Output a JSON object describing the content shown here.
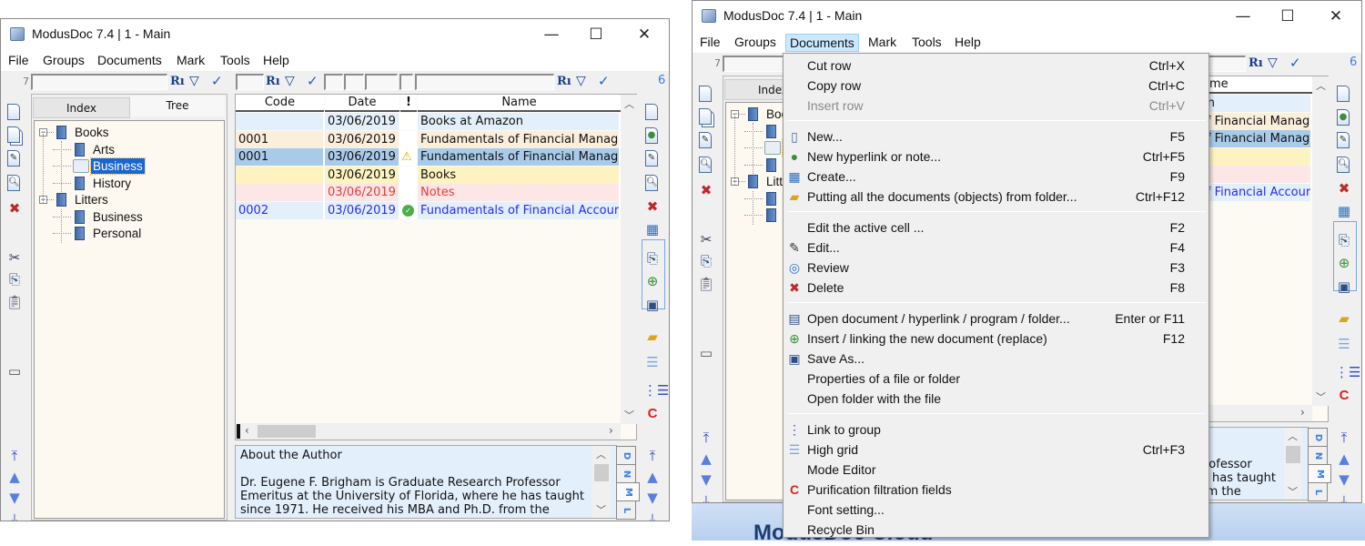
{
  "window": {
    "title": "ModusDoc 7.4 | 1 - Main",
    "controls": {
      "minimize": "—",
      "maximize": "☐",
      "close": "✕"
    }
  },
  "menubar": [
    "File",
    "Groups",
    "Documents",
    "Mark",
    "Tools",
    "Help"
  ],
  "active_menu": "Documents",
  "filter_bar": {
    "left_count": "7",
    "right_count": "6",
    "filter_labels": [
      "Rı",
      "Rı",
      "Rı"
    ]
  },
  "tabs": {
    "index": "Index",
    "tree": "Tree",
    "selected": "Tree"
  },
  "tree": [
    {
      "label": "Books",
      "level": 0,
      "expanded": true
    },
    {
      "label": "Arts",
      "level": 1
    },
    {
      "label": "Business",
      "level": 1,
      "selected": true,
      "icon": "open-book"
    },
    {
      "label": "History",
      "level": 1
    },
    {
      "label": "Litters",
      "level": 0,
      "expanded": true
    },
    {
      "label": "Business",
      "level": 1
    },
    {
      "label": "Personal",
      "level": 1
    }
  ],
  "grid": {
    "columns": [
      "Code",
      "Date",
      "!",
      "Name"
    ],
    "rows": [
      {
        "code": "",
        "date": "03/06/2019",
        "flag": "",
        "name": "Books at Amazon",
        "bg": "#e3effb",
        "color": "#111111"
      },
      {
        "code": "0001",
        "date": "03/06/2019",
        "flag": "",
        "name": "Fundamentals of Financial Manag",
        "bg": "#fbeedb",
        "color": "#111111"
      },
      {
        "code": "0001",
        "date": "03/06/2019",
        "flag": "warning",
        "name": "Fundamentals of Financial Manag",
        "bg": "#a9cbea",
        "color": "#111111"
      },
      {
        "code": "",
        "date": "03/06/2019",
        "flag": "",
        "name": "Books",
        "bg": "#fdf3c0",
        "color": "#111111"
      },
      {
        "code": "",
        "date": "03/06/2019",
        "flag": "",
        "name": "Notes",
        "bg": "#fde6e6",
        "color": "#e83a3a"
      },
      {
        "code": "0002",
        "date": "03/06/2019",
        "flag": "ok",
        "name": "Fundamentals of Financial Accour",
        "bg": "#e3effb",
        "color": "#2b2bef"
      }
    ]
  },
  "notes": {
    "lines": [
      "About the Author",
      "",
      "Dr. Eugene F. Brigham is Graduate Research Professor",
      "Emeritus at the University of Florida, where he has taught",
      "since 1971. He received his MBA and Ph.D. from the"
    ],
    "tabs": [
      "D",
      "N",
      "M",
      "L"
    ]
  },
  "documents_menu": [
    {
      "label": "Cut row",
      "shortcut": "Ctrl+X"
    },
    {
      "label": "Copy row",
      "shortcut": "Ctrl+C"
    },
    {
      "label": "Insert row",
      "shortcut": "Ctrl+V",
      "disabled": true
    },
    {
      "separator": true
    },
    {
      "label": "New...",
      "shortcut": "F5",
      "icon": "new-document"
    },
    {
      "label": "New hyperlink or note...",
      "shortcut": "Ctrl+F5",
      "icon": "globe-document"
    },
    {
      "label": "Create...",
      "shortcut": "F9",
      "icon": "create-form"
    },
    {
      "label": "Putting all the documents (objects) from folder...",
      "shortcut": "Ctrl+F12",
      "icon": "folder-documents"
    },
    {
      "separator": true
    },
    {
      "label": "Edit the active cell ...",
      "shortcut": "F2"
    },
    {
      "label": "Edit...",
      "shortcut": "F4",
      "icon": "edit-pencil"
    },
    {
      "label": "Review",
      "shortcut": "F3",
      "icon": "review-magnifier"
    },
    {
      "label": "Delete",
      "shortcut": "F8",
      "icon": "delete-x"
    },
    {
      "separator": true
    },
    {
      "label": "Open document / hyperlink / program / folder...",
      "shortcut": "Enter or F11",
      "icon": "open-document"
    },
    {
      "label": "Insert / linking the new document (replace)",
      "shortcut": "F12",
      "icon": "insert-link"
    },
    {
      "label": "Save As...",
      "shortcut": "",
      "icon": "save-disk"
    },
    {
      "label": "Properties of a file or folder",
      "shortcut": ""
    },
    {
      "label": "Open folder with the file",
      "shortcut": ""
    },
    {
      "separator": true
    },
    {
      "label": "Link to group",
      "shortcut": "",
      "icon": "link-group"
    },
    {
      "label": "High grid",
      "shortcut": "Ctrl+F3",
      "icon": "high-grid"
    },
    {
      "label": "Mode Editor",
      "shortcut": ""
    },
    {
      "label": "Purification filtration fields",
      "shortcut": "",
      "icon": "purification-c"
    },
    {
      "label": "Font setting...",
      "shortcut": ""
    },
    {
      "label": "Recycle Bin",
      "shortcut": ""
    }
  ],
  "desktop_text": "ModusDoc Cloud",
  "colors": {
    "selection": "#1a66cc",
    "menu_highlight": "#cce8ff",
    "notes_bg": "#e3effb",
    "grid_bg": "#fdf9f3"
  }
}
